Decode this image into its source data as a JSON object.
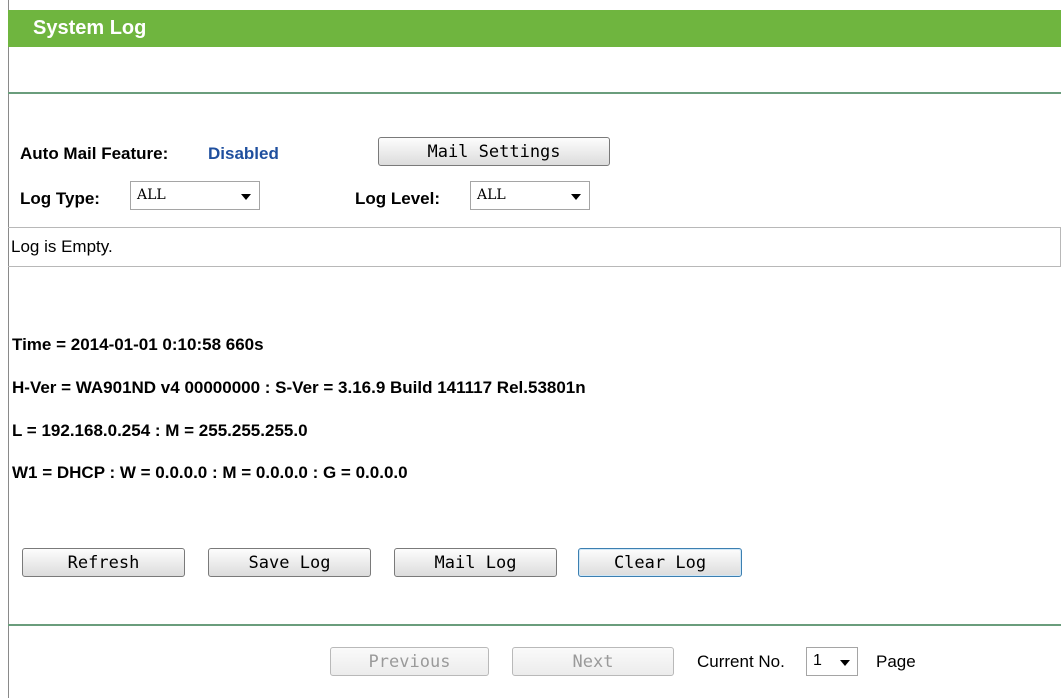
{
  "page": {
    "title": "System Log"
  },
  "mail": {
    "feature_label": "Auto Mail Feature:",
    "feature_status": "Disabled",
    "settings_button": "Mail Settings"
  },
  "filters": {
    "log_type_label": "Log Type:",
    "log_type_value": "ALL",
    "log_level_label": "Log Level:",
    "log_level_value": "ALL"
  },
  "log": {
    "content": "Log is Empty."
  },
  "system_info": {
    "time": "Time = 2014-01-01 0:10:58 660s",
    "version": "H-Ver = WA901ND v4 00000000 : S-Ver = 3.16.9 Build 141117 Rel.53801n",
    "lan": "L = 192.168.0.254 : M = 255.255.255.0",
    "wan": "W1 = DHCP : W = 0.0.0.0 : M = 0.0.0.0 : G = 0.0.0.0"
  },
  "actions": {
    "refresh": "Refresh",
    "save_log": "Save Log",
    "mail_log": "Mail Log",
    "clear_log": "Clear Log"
  },
  "pagination": {
    "previous": "Previous",
    "next": "Next",
    "current_label": "Current No.",
    "current_value": "1",
    "page_label": "Page"
  },
  "colors": {
    "title_bar": "#6fb53f",
    "status_text": "#1f4f9e",
    "divider": "#6a9d7c"
  }
}
